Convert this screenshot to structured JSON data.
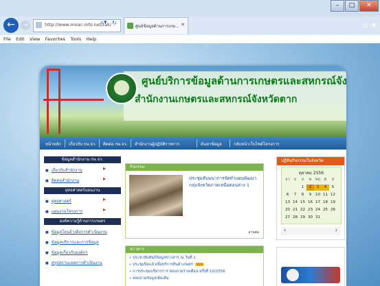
{
  "browser": {
    "url": "http://www.moac-info.net/tak/",
    "tab_label": "ศูนย์ข้อมูลด้านการเกษ...",
    "menu": [
      "File",
      "Edit",
      "View",
      "Favorites",
      "Tools",
      "Help"
    ]
  },
  "site": {
    "title_line1": "ศูนย์บริการข้อมูลด้านการเกษตรและสหกรณ์จังหวัด",
    "title_line2": "สำนักงานเกษตรและสหกรณ์จังหวัดตาก",
    "topnav": [
      "หน้าหลัก",
      "เกี่ยวกับ กษ.จว.",
      "ติดต่อ กษ.จว.",
      "สำนักงานผู้ปฏิบัติราชการ",
      "ค้นหาข้อมูล",
      "กลับหน้าเว็บไซต์โครงการ"
    ],
    "left_sections": [
      {
        "header": "ข้อมูลสำนักงาน กษ.จว.",
        "items": [
          "เกี่ยวกับสำนักงาน",
          "ติดต่อสำนักงาน"
        ]
      },
      {
        "header": "ยุทธศาสตร์แผนงาน",
        "items": [
          "ยุทธศาสตร์",
          "แผนงานโครงการ"
        ]
      },
      {
        "header": "องค์ความรู้ด้านการเกษตร",
        "items": [
          "ข้อมูลโอนอ้างอิงการดำเนินงาน",
          "ข้อมูลบริการและการข้อมูล",
          "ข้อมูลเกี่ยวกับองค์กร",
          "สรุปสถานะผลการดำเนินงาน"
        ]
      }
    ],
    "news_header": "กิจกรรม",
    "news_title": "ประชุมสัมมนาการจัดทำแผนพัฒนากลุ่มจังหวัดภาคเหนือตอนล่าง 1",
    "news_more": "อ่านต่อ",
    "announce_header": "ข่าวสาร",
    "announce_items": [
      "ประชาสัมพันธ์ข้อมูลข่าวสาร ณ วันที่ 1",
      "ประชุมปิดแล้วเพื่อบริการสินค้าเกษตร",
      "การประชุมบริหารการ สอบถามรายเดือน ครั้งที่ 10/2556",
      "สอบถามข้อมูลเพิ่มเติม"
    ],
    "new_badge": "NEW",
    "right_header": "ปฏิทินกิจกรรมในจังหวัด",
    "calendar": {
      "month": "ตุลาคม 2556",
      "dow": [
        "อา",
        "จ",
        "อ",
        "พ",
        "พฤ",
        "ศ",
        "ส"
      ],
      "days": [
        "",
        "",
        "1",
        "2",
        "3",
        "4",
        "5",
        "6",
        "7",
        "8",
        "9",
        "10",
        "11",
        "12",
        "13",
        "14",
        "15",
        "16",
        "17",
        "18",
        "19",
        "20",
        "21",
        "22",
        "23",
        "24",
        "25",
        "26",
        "27",
        "28",
        "29",
        "30",
        "31"
      ],
      "highlighted": [
        "2",
        "3",
        "4"
      ]
    },
    "cal_prev": "‹",
    "cal_next": "›",
    "icons": {
      "back": "back-arrow-icon",
      "forward": "forward-arrow-icon"
    }
  }
}
